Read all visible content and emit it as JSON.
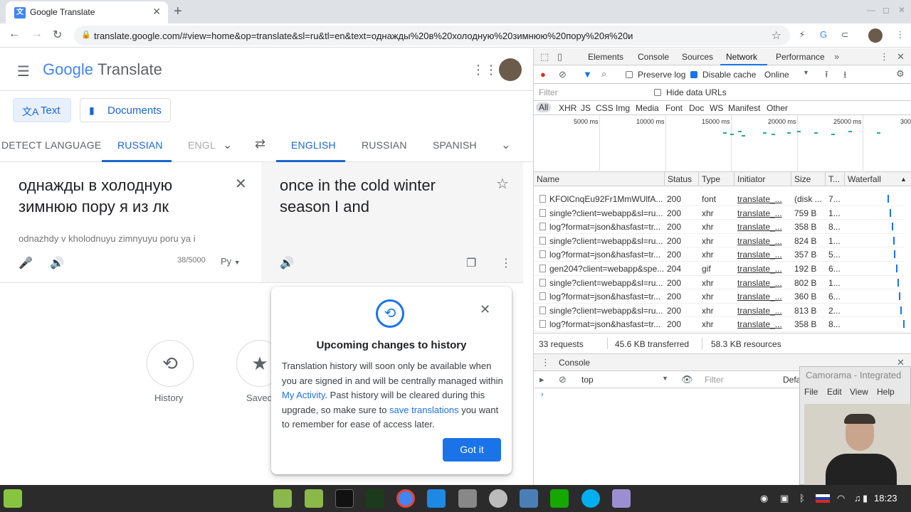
{
  "browser": {
    "tab_title": "Google Translate",
    "url": "translate.google.com/#view=home&op=translate&sl=ru&tl=en&text=однажды%20в%20холодную%20зимнюю%20пору%20я%20и"
  },
  "translate": {
    "logo_brand": "Google",
    "logo_product": "Translate",
    "mode_text": "Text",
    "mode_documents": "Documents",
    "source_langs": [
      "DETECT LANGUAGE",
      "RUSSIAN",
      "ENGL"
    ],
    "target_langs": [
      "ENGLISH",
      "RUSSIAN",
      "SPANISH"
    ],
    "source_text_line1": "однажды в холодную",
    "source_text_line2": "зимнюю пору я из лк",
    "transliteration": "odnazhdy v kholodnuyu zimnyuyu poru ya i",
    "char_count": "38/5000",
    "keyboard_label": "Ру",
    "target_text_line1": "once in the cold winter",
    "target_text_line2": "season I and",
    "history_label": "History",
    "saved_label": "Saved"
  },
  "popup": {
    "title": "Upcoming changes to history",
    "body_part1": "Translation history will soon only be available when you are signed in and will be centrally managed within ",
    "link1": "My Activity",
    "body_part2": ". Past history will be cleared during this upgrade, so make sure to ",
    "link2": "save translations",
    "body_part3": " you want to remember for ease of access later.",
    "button": "Got it"
  },
  "devtools": {
    "tabs": [
      "Elements",
      "Console",
      "Sources",
      "Network",
      "Performance"
    ],
    "preserve_log": "Preserve log",
    "disable_cache": "Disable cache",
    "throttle": "Online",
    "filter_placeholder": "Filter",
    "hide_data_urls": "Hide data URLs",
    "types": [
      "All",
      "XHR",
      "JS",
      "CSS",
      "Img",
      "Media",
      "Font",
      "Doc",
      "WS",
      "Manifest",
      "Other"
    ],
    "ticks": [
      "5000 ms",
      "10000 ms",
      "15000 ms",
      "20000 ms",
      "25000 ms",
      "300"
    ],
    "columns": [
      "Name",
      "Status",
      "Type",
      "Initiator",
      "Size",
      "T...",
      "Waterfall"
    ],
    "rows": [
      {
        "name": "KFOlCnqEu92Fr1MmWUlfA...",
        "status": "200",
        "type": "font",
        "initiator": "translate_...",
        "size": "(disk ...",
        "time": "7..."
      },
      {
        "name": "single?client=webapp&sl=ru...",
        "status": "200",
        "type": "xhr",
        "initiator": "translate_...",
        "size": "759 B",
        "time": "1..."
      },
      {
        "name": "log?format=json&hasfast=tr...",
        "status": "200",
        "type": "xhr",
        "initiator": "translate_...",
        "size": "358 B",
        "time": "8..."
      },
      {
        "name": "single?client=webapp&sl=ru...",
        "status": "200",
        "type": "xhr",
        "initiator": "translate_...",
        "size": "824 B",
        "time": "1..."
      },
      {
        "name": "log?format=json&hasfast=tr...",
        "status": "200",
        "type": "xhr",
        "initiator": "translate_...",
        "size": "357 B",
        "time": "5..."
      },
      {
        "name": "gen204?client=webapp&spe...",
        "status": "204",
        "type": "gif",
        "initiator": "translate_...",
        "size": "192 B",
        "time": "6..."
      },
      {
        "name": "single?client=webapp&sl=ru...",
        "status": "200",
        "type": "xhr",
        "initiator": "translate_...",
        "size": "802 B",
        "time": "1..."
      },
      {
        "name": "log?format=json&hasfast=tr...",
        "status": "200",
        "type": "xhr",
        "initiator": "translate_...",
        "size": "360 B",
        "time": "6..."
      },
      {
        "name": "single?client=webapp&sl=ru...",
        "status": "200",
        "type": "xhr",
        "initiator": "translate_...",
        "size": "813 B",
        "time": "2..."
      },
      {
        "name": "log?format=json&hasfast=tr...",
        "status": "200",
        "type": "xhr",
        "initiator": "translate_...",
        "size": "358 B",
        "time": "8..."
      }
    ],
    "summary_requests": "33 requests",
    "summary_transferred": "45.6 KB transferred",
    "summary_resources": "58.3 KB resources",
    "console_tab": "Console",
    "context": "top",
    "console_filter": "Filter",
    "console_default": "Defa"
  },
  "camorama": {
    "title": "Camorama - Integrated",
    "menu": [
      "File",
      "Edit",
      "View",
      "Help"
    ]
  },
  "taskbar": {
    "clock": "18:23"
  },
  "colors": {
    "accent_blue": "#1a73e8",
    "devtools_bg": "#f3f3f3",
    "taskbar_bg": "#2b2b2b"
  }
}
